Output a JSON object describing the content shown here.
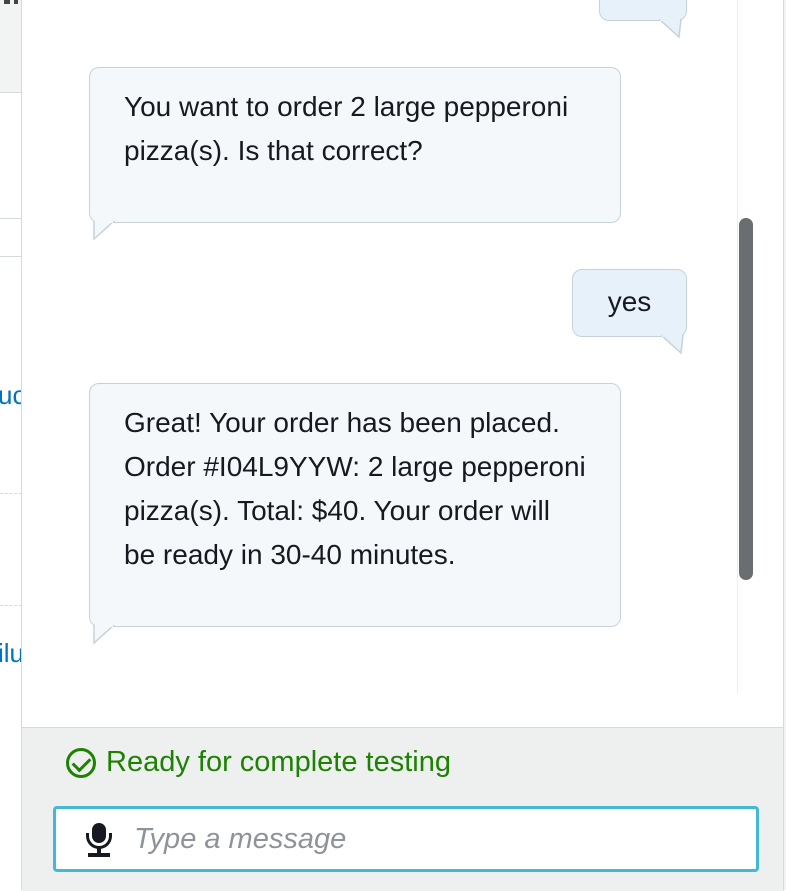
{
  "background_page": {
    "fragments": [
      "uc",
      "ilu"
    ]
  },
  "chat": {
    "messages": [
      {
        "sender": "bot",
        "text": "You want to order 2 large pepperoni pizza(s). Is that correct?"
      },
      {
        "sender": "user",
        "text": "yes"
      },
      {
        "sender": "bot",
        "text": "Great! Your order has been placed. Order #I04L9YYW: 2 large pepperoni pizza(s). Total: $40. Your order will be ready in 30-40 minutes."
      }
    ]
  },
  "status": {
    "text": "Ready for complete testing",
    "color": "#1d8102"
  },
  "input": {
    "placeholder": "Type a message",
    "value": ""
  },
  "colors": {
    "bot_bubble": "#f4f8fb",
    "user_bubble": "#e6f1fa",
    "input_focus_border": "#44b9d6",
    "link": "#0073bb"
  },
  "icons": {
    "status": "check-circle-icon",
    "input": "microphone-icon"
  }
}
